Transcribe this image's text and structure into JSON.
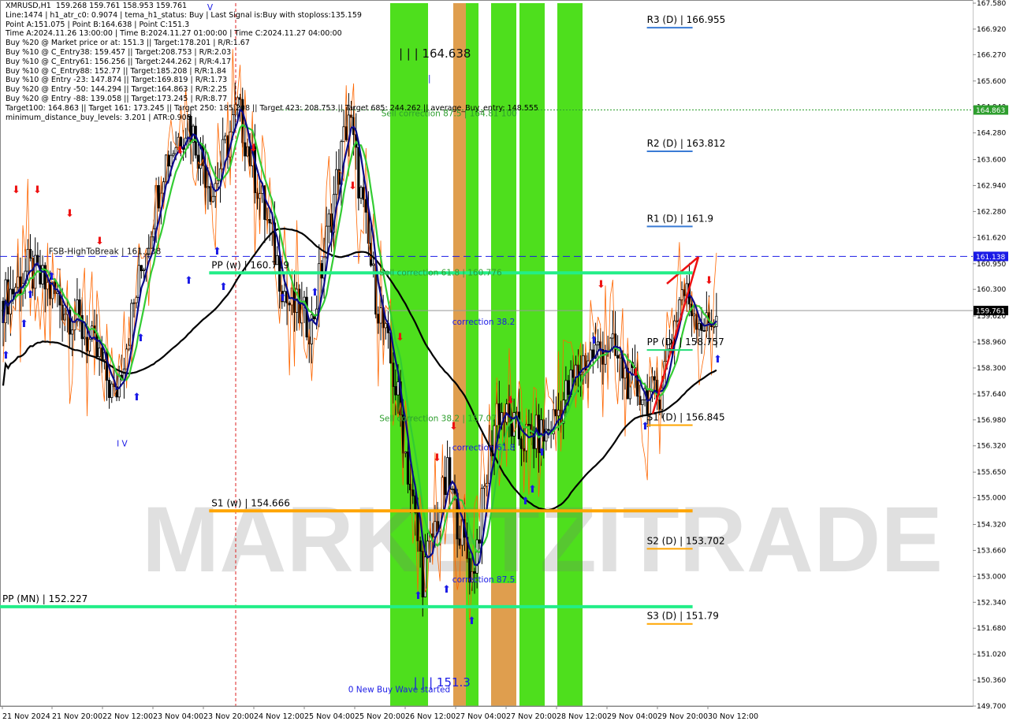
{
  "header_lines": [
    "XMRUSD,H1  159.268 159.761 158.953 159.761",
    "Line:1474 | h1_atr_c0: 0.9074 | tema_h1_status: Buy | Last Signal is:Buy with stoploss:135.159",
    "Point A:151.075 | Point B:164.638 | Point C:151.3",
    "Time A:2024.11.26 13:00:00 | Time B:2024.11.27 01:00:00 | Time C:2024.11.27 04:00:00",
    "Buy %20 @ Market price or at: 151.3 || Target:178.201 | R/R:1.67",
    "Buy %10 @ C_Entry38: 159.457 || Target:208.753 | R/R:2.03",
    "Buy %10 @ C_Entry61: 156.256 || Target:244.262 | R/R:4.17",
    "Buy %10 @ C_Entry88: 152.77 || Target:185.208 | R/R:1.84",
    "Buy %10 @ Entry -23: 147.874 || Target:169.819 | R/R:1.73",
    "Buy %20 @ Entry -50: 144.294 || Target:164.863 | R/R:2.25",
    "Buy %20 @ Entry -88: 139.058 || Target:173.245 | R/R:8.77",
    "Target100: 164.863 || Target 161: 173.245 || Target 250: 185.208 || Target 423: 208.753 || Target 685: 244.262 || average_Buy_entry: 148.555",
    "minimum_distance_buy_levels: 3.201 | ATR:0.908"
  ],
  "chart_data": {
    "type": "candlestick",
    "symbol": "XMRUSD",
    "timeframe": "H1",
    "ylim": [
      149.7,
      167.58
    ],
    "y_ticks": [
      "167.580",
      "166.920",
      "166.270",
      "165.600",
      "164.940",
      "164.280",
      "163.600",
      "162.940",
      "162.280",
      "161.620",
      "160.950",
      "160.300",
      "159.620",
      "158.960",
      "158.300",
      "157.640",
      "156.980",
      "156.320",
      "155.650",
      "155.000",
      "154.320",
      "153.660",
      "153.000",
      "152.340",
      "151.680",
      "151.020",
      "150.360",
      "149.700"
    ],
    "x_labels": [
      "21 Nov 2024",
      "21 Nov 20:00",
      "22 Nov 12:00",
      "23 Nov 04:00",
      "23 Nov 20:00",
      "24 Nov 12:00",
      "25 Nov 04:00",
      "25 Nov 20:00",
      "26 Nov 12:00",
      "27 Nov 04:00",
      "27 Nov 20:00",
      "28 Nov 12:00",
      "29 Nov 04:00",
      "29 Nov 20:00",
      "30 Nov 12:00"
    ],
    "last_price": 159.761,
    "price_tags": [
      {
        "text": "164.863",
        "value": 164.863,
        "color": "#2e9e2e"
      },
      {
        "text": "161.138",
        "value": 161.138,
        "color": "#1a1ae6"
      },
      {
        "text": "159.761",
        "value": 159.761,
        "color": "#000000"
      }
    ],
    "levels": [
      {
        "label": "R3 (D) | 166.955",
        "value": 166.955,
        "color": "#3a7bd5",
        "x0": 0.665,
        "x1": 0.712
      },
      {
        "label": "R2 (D) | 163.812",
        "value": 163.812,
        "color": "#3a7bd5",
        "x0": 0.665,
        "x1": 0.712
      },
      {
        "label": "R1 (D) | 161.9",
        "value": 161.9,
        "color": "#3a7bd5",
        "x0": 0.665,
        "x1": 0.712
      },
      {
        "label": "PP (D) | 158.757",
        "value": 158.757,
        "color": "#22dd77",
        "x0": 0.665,
        "x1": 0.712
      },
      {
        "label": "S1 (D) | 156.845",
        "value": 156.845,
        "color": "#ffa500",
        "x0": 0.665,
        "x1": 0.712
      },
      {
        "label": "S2 (D) | 153.702",
        "value": 153.702,
        "color": "#ffa500",
        "x0": 0.665,
        "x1": 0.712
      },
      {
        "label": "S3 (D) | 151.79",
        "value": 151.79,
        "color": "#ffa500",
        "x0": 0.665,
        "x1": 0.712
      },
      {
        "label": "PP (w) | 160.719",
        "value": 160.719,
        "color": "#22ee88",
        "x0": 0.215,
        "x1": 0.712
      },
      {
        "label": "S1 (w) | 154.666",
        "value": 154.666,
        "color": "#ffa500",
        "x0": 0.215,
        "x1": 0.712
      },
      {
        "label": "PP (MN) | 152.227",
        "value": 152.227,
        "color": "#22ee88",
        "x0": 0.0,
        "x1": 0.712
      }
    ],
    "annotations": [
      {
        "text": "| | | 164.638",
        "value": 166.2,
        "x": 0.41,
        "color": "#111111"
      },
      {
        "text": "|",
        "value": 165.6,
        "x": 0.44,
        "color": "#1a1ae6"
      },
      {
        "text": "Sell correction 87.5 | 164.81 100",
        "value": 164.7,
        "x": 0.392,
        "color": "#2e9e2e"
      },
      {
        "text": "Sell correction 61.8 | 160.776",
        "value": 160.65,
        "x": 0.39,
        "color": "#2e9e2e"
      },
      {
        "text": "correction 38.2",
        "value": 159.4,
        "x": 0.465,
        "color": "#1a1ae6"
      },
      {
        "text": "Sell correction 38.2 | 157.07",
        "value": 156.95,
        "x": 0.39,
        "color": "#2e9e2e"
      },
      {
        "text": "correction 61.8",
        "value": 156.2,
        "x": 0.465,
        "color": "#1a1ae6"
      },
      {
        "text": "correction 87.5",
        "value": 152.85,
        "x": 0.465,
        "color": "#1a1ae6"
      },
      {
        "text": "| | | 151.3",
        "value": 150.2,
        "x": 0.425,
        "color": "#1a1ae6"
      },
      {
        "text": "0 New Buy Wave started",
        "value": 150.05,
        "x": 0.358,
        "color": "#1a1ae6"
      },
      {
        "text": "I V",
        "value": 156.3,
        "x": 0.12,
        "color": "#1a1ae6"
      },
      {
        "text": "V",
        "value": 167.4,
        "x": 0.213,
        "color": "#1a1ae6"
      },
      {
        "text": "FSB-HighToBreak | 161.138",
        "value": 161.2,
        "x": 0.05,
        "color": "#111111"
      }
    ],
    "watermark": "MARKETZITRADE"
  },
  "colors": {
    "bull": "#000000",
    "bear": "#000000",
    "green_zone": "#33dd00",
    "orange_zone": "#dd8822",
    "tema_navy": "#0a0a8a",
    "ema_green": "#33cc33",
    "ma_black": "#000000",
    "stop_red": "#ff3300"
  }
}
